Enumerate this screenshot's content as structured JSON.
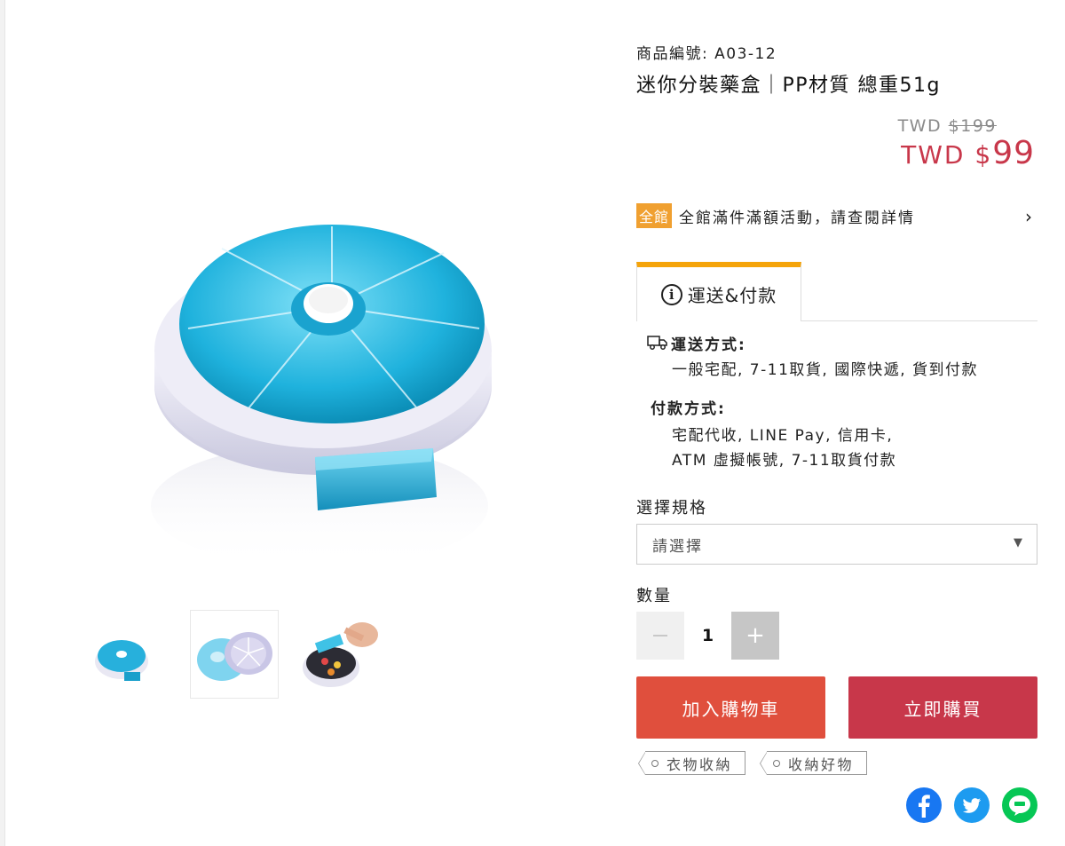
{
  "product": {
    "sku_label": "商品編號: A03-12",
    "title": "迷你分裝藥盒｜PP材質 總重51g",
    "original_price_prefix": "TWD",
    "original_price": "$199",
    "sale_price_prefix": "TWD",
    "sale_price_currency": "$",
    "sale_price": "99"
  },
  "promo": {
    "badge": "全館",
    "text": "全館滿件滿額活動，請查閱詳情",
    "chevron": "›"
  },
  "tabs": [
    {
      "label": "運送&付款",
      "icon": "info-icon",
      "active": true
    }
  ],
  "shipping": {
    "title": "運送方式:",
    "methods": "一般宅配, 7-11取貨, 國際快遞, 貨到付款"
  },
  "payment": {
    "title": "付款方式:",
    "line1": "宅配代收, LINE Pay, 信用卡,",
    "line2": "ATM 虛擬帳號, 7-11取貨付款"
  },
  "spec": {
    "label": "選擇規格",
    "selected": "請選擇"
  },
  "quantity": {
    "label": "數量",
    "value": "1",
    "plus": "+"
  },
  "actions": {
    "add_to_cart": "加入購物車",
    "buy_now": "立即購買"
  },
  "tags": [
    "衣物收納",
    "收納好物"
  ],
  "social": [
    {
      "icon": "facebook-icon",
      "color": "#1877f2"
    },
    {
      "icon": "twitter-icon",
      "color": "#1d9bf0"
    },
    {
      "icon": "line-icon",
      "color": "#06c755"
    }
  ],
  "colors": {
    "accent_orange": "#f5a40a",
    "sale_red": "#c8374a",
    "cart_red": "#e04f3d",
    "pillbox_blue": "#29b5e0"
  }
}
